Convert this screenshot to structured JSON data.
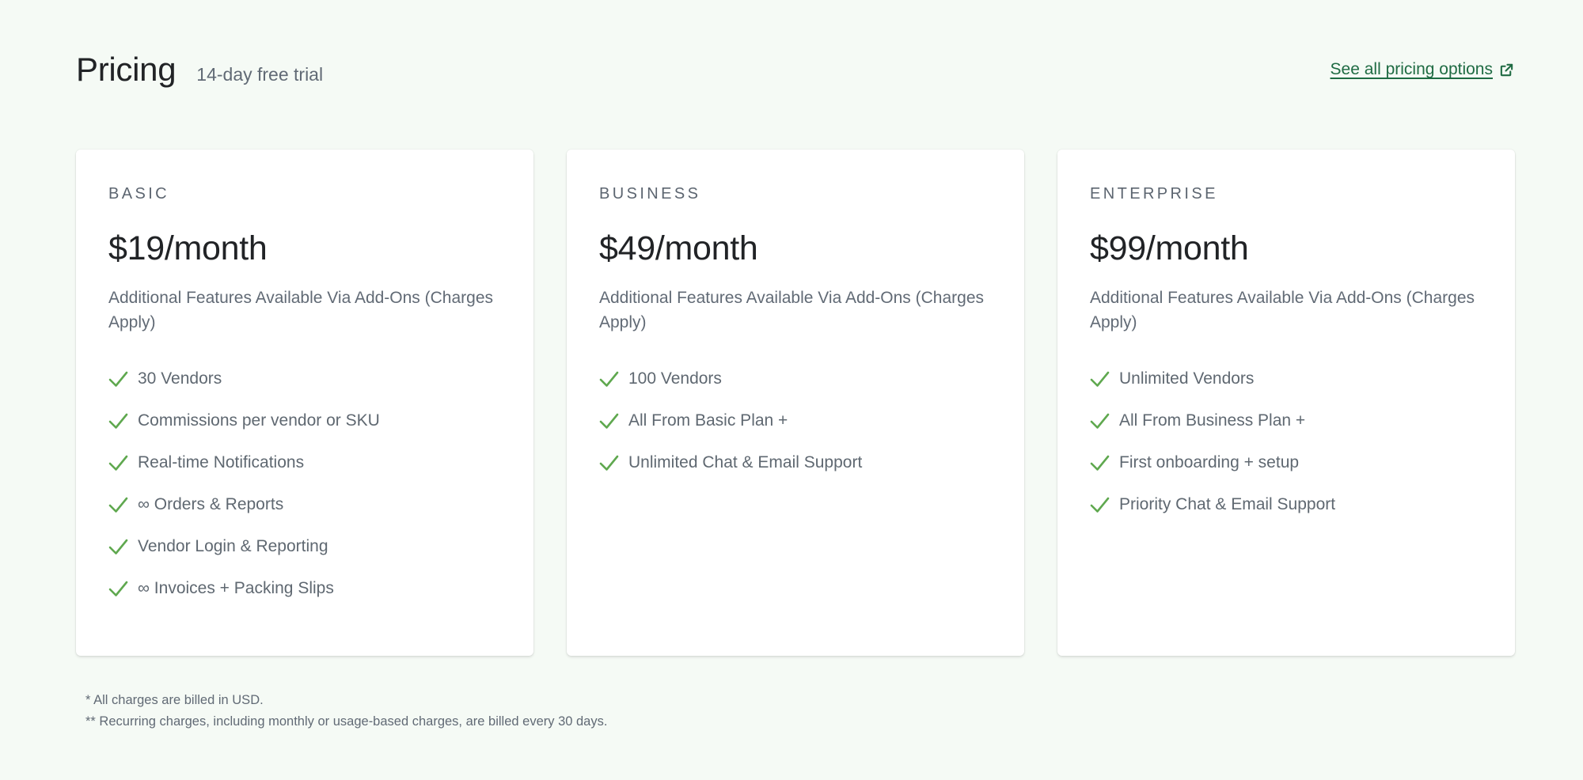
{
  "header": {
    "title": "Pricing",
    "trial": "14-day free trial",
    "link_label": "See all pricing options"
  },
  "colors": {
    "background": "#f5faf5",
    "link": "#1f6b43",
    "check": "#5fa84f"
  },
  "plans": [
    {
      "name": "BASIC",
      "price": "$19/month",
      "description": "Additional Features Available Via Add-Ons (Charges Apply)",
      "features": [
        "30 Vendors",
        "Commissions per vendor or SKU",
        "Real-time Notifications",
        "∞ Orders & Reports",
        "Vendor Login & Reporting",
        "∞ Invoices + Packing Slips"
      ]
    },
    {
      "name": "BUSINESS",
      "price": "$49/month",
      "description": "Additional Features Available Via Add-Ons (Charges Apply)",
      "features": [
        "100 Vendors",
        "All From Basic Plan +",
        "Unlimited Chat & Email Support"
      ]
    },
    {
      "name": "ENTERPRISE",
      "price": "$99/month",
      "description": "Additional Features Available Via Add-Ons (Charges Apply)",
      "features": [
        "Unlimited Vendors",
        "All From Business Plan +",
        "First onboarding + setup",
        "Priority Chat & Email Support"
      ]
    }
  ],
  "footnotes": [
    "* All charges are billed in USD.",
    "** Recurring charges, including monthly or usage-based charges, are billed every 30 days."
  ]
}
